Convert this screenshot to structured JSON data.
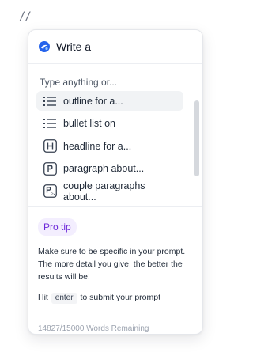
{
  "editor": {
    "typed_text": "//"
  },
  "popover": {
    "title": "Write a",
    "section_label": "Type anything or...",
    "items": [
      {
        "label": "outline for a...",
        "icon": "list-icon"
      },
      {
        "label": "bullet list on",
        "icon": "list-icon"
      },
      {
        "label": "headline for a...",
        "icon": "h-letter-icon"
      },
      {
        "label": "paragraph about...",
        "icon": "p-letter-icon"
      },
      {
        "label": "couple paragraphs about...",
        "icon": "p2x-letter-icon"
      }
    ],
    "tip_badge": "Pro tip",
    "tip_text": "Make sure to be specific in your prompt. The more detail you give, the better the results will be!",
    "hint_prefix": "Hit",
    "hint_key": "enter",
    "hint_suffix": "to submit your prompt",
    "footer": "14827/15000 Words Remaining"
  },
  "colors": {
    "accent": "#6d28d9",
    "accent_bg": "#f3eefe",
    "logo_blue": "#2563eb"
  }
}
